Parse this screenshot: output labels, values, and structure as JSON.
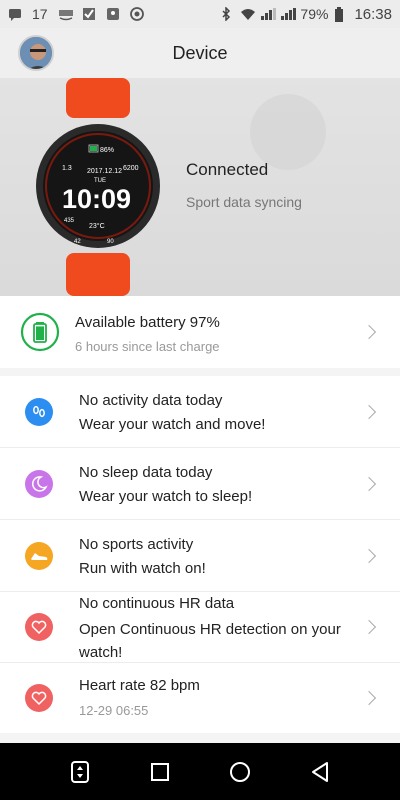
{
  "statusbar": {
    "notif_count": "17",
    "battery": "79%",
    "time": "16:38"
  },
  "header": {
    "title": "Device"
  },
  "device": {
    "status": "Connected",
    "sync_status": "Sport data syncing",
    "watch_face": {
      "battery": "86%",
      "date": "2017.12.12",
      "day": "TUE",
      "time": "10:09",
      "left_top": "1.3",
      "right_top": "6200",
      "left_mid": "435",
      "temp": "23°C",
      "bottom_left": "42",
      "bottom_right": "90"
    }
  },
  "battery_card": {
    "title": "Available battery 97%",
    "subtitle": "6 hours since last charge",
    "level": 0.97
  },
  "rows": [
    {
      "title": "No activity data today",
      "subtitle": "Wear your watch and move!",
      "icon": "footsteps-icon",
      "color": "#2b8ef0"
    },
    {
      "title": "No sleep data today",
      "subtitle": "Wear your watch to sleep!",
      "icon": "moon-icon",
      "color": "#c775e8"
    },
    {
      "title": "No sports activity",
      "subtitle": "Run with watch on!",
      "icon": "shoe-icon",
      "color": "#f5a623"
    },
    {
      "title": "No continuous HR data",
      "subtitle": "Open Continuous HR detection on your watch!",
      "icon": "heart-icon",
      "color": "#f06262"
    },
    {
      "title": "Heart rate 82 bpm",
      "subtitle": "12-29 06:55",
      "icon": "heart-icon",
      "color": "#f06262"
    }
  ],
  "colors": {
    "accent_green": "#21b14a",
    "watch_band": "#f04a1f"
  }
}
